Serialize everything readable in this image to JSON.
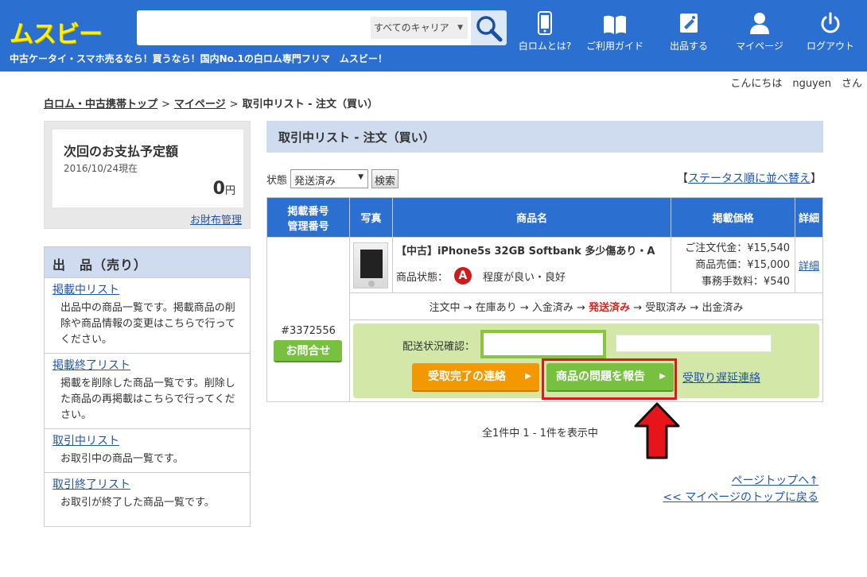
{
  "header": {
    "logo": "ムスビー",
    "tagline": "中古ケータイ・スマホ売るなら！買うなら！国内No.1の白ロム専門フリマ　ムスビー！",
    "search_placeholder": "",
    "carrier_select": "すべてのキャリア",
    "nav": [
      {
        "label": "白ロムとは?",
        "icon": "phone-icon"
      },
      {
        "label": "ご利用ガイド",
        "icon": "book-icon"
      },
      {
        "label": "出品する",
        "icon": "tag-icon"
      },
      {
        "label": "マイページ",
        "icon": "user-icon"
      },
      {
        "label": "ログアウト",
        "icon": "power-icon"
      }
    ]
  },
  "greeting": "こんにちは　nguyen　さん",
  "breadcrumb": {
    "items": [
      "白ロム・中古携帯トップ",
      "マイページ",
      "取引中リスト - 注文（買い）"
    ],
    "separator": ">"
  },
  "payment": {
    "title": "次回のお支払予定額",
    "date": "2016/10/24現在",
    "amount": "0",
    "unit": "円",
    "wallet_link": "お財布管理"
  },
  "sell_menu": {
    "title": "出　品（売り）",
    "items": [
      {
        "label": "掲載中リスト",
        "desc": "出品中の商品一覧です。掲載商品の削除や商品情報の変更はこちらで行ってください。"
      },
      {
        "label": "掲載終了リスト",
        "desc": "掲載を削除した商品一覧です。削除した商品の再掲載はこちらで行ってください。"
      },
      {
        "label": "取引中リスト",
        "desc": "お取引中の商品一覧です。"
      },
      {
        "label": "取引終了リスト",
        "desc": "お取引が終了した商品一覧です。"
      }
    ]
  },
  "main": {
    "title": "取引中リスト - 注文（買い）",
    "filter_label": "状態",
    "filter_value": "発送済み",
    "search_button": "検索",
    "sort_link_open": "【",
    "sort_link": "ステータス順に並べ替え",
    "sort_link_close": "】",
    "columns": [
      "掲載番号\n管理番号",
      "写真",
      "商品名",
      "掲載価格",
      "詳細"
    ],
    "order": {
      "id": "#3372556",
      "contact_button": "お問合せ",
      "product_name": "【中古】iPhone5s 32GB Softbank 多少傷あり・A",
      "condition_label": "商品状態：",
      "grade": "A",
      "condition_text": "程度が良い・良好",
      "price_lines": [
        "ご注文代金：¥15,540",
        "商品売価：¥15,000",
        "事務手数料：¥540"
      ],
      "detail_link": "詳細",
      "status_steps": [
        "注文中",
        "在庫あり",
        "入金済み",
        "発送済み",
        "受取済み",
        "出金済み"
      ],
      "current_step": 3,
      "delivery_label": "配送状況確認：",
      "receive_button": "受取完了の連絡",
      "report_button": "商品の問題を報告",
      "delay_link": "受取り遅延連絡"
    },
    "pagination": "全1件中 1 - 1件を表示中",
    "page_top": "ページトップへ↑",
    "back_link": "<< マイページのトップに戻る"
  }
}
